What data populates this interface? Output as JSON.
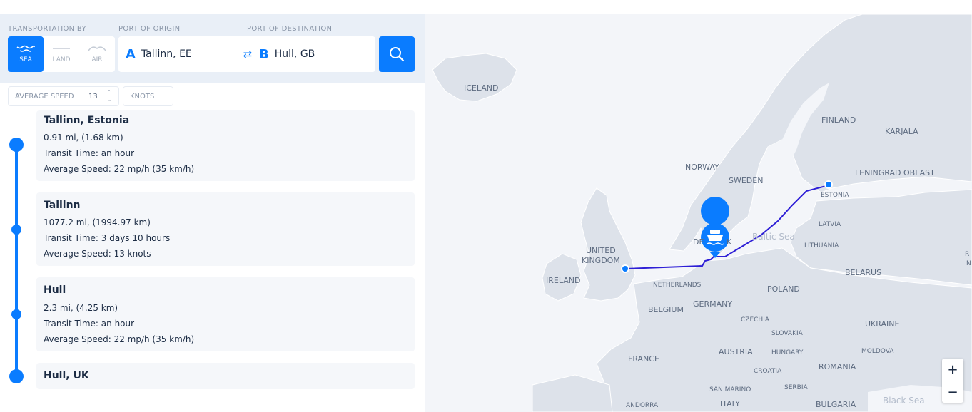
{
  "search": {
    "transport_label": "TRANSPORTATION BY",
    "origin_label": "PORT OF ORIGIN",
    "destination_label": "PORT OF DESTINATION",
    "modes": [
      {
        "label": "SEA",
        "icon": "waves-icon",
        "active": true
      },
      {
        "label": "LAND",
        "icon": "road-icon",
        "active": false
      },
      {
        "label": "AIR",
        "icon": "arc-icon",
        "active": false
      }
    ],
    "origin_letter": "A",
    "origin_value": "Tallinn, EE",
    "swap_icon": "⇄",
    "destination_letter": "B",
    "destination_value": "Hull, GB",
    "search_icon": "search-icon"
  },
  "speed": {
    "label": "AVERAGE SPEED",
    "value": "13",
    "unit": "KNOTS"
  },
  "legs": [
    {
      "title": "Tallinn, Estonia",
      "distance": "0.91 mi, (1.68 km)",
      "transit": "Transit Time: an hour",
      "speed": "Average Speed: 22 mp/h (35 km/h)"
    },
    {
      "title": "Tallinn",
      "distance": "1077.2 mi, (1994.97 km)",
      "transit": "Transit Time: 3 days 10 hours",
      "speed": "Average Speed: 13 knots"
    },
    {
      "title": "Hull",
      "distance": "2.3 mi, (4.25 km)",
      "transit": "Transit Time: an hour",
      "speed": "Average Speed: 22 mp/h (35 km/h)"
    },
    {
      "title": "Hull, UK"
    }
  ],
  "map": {
    "labels": {
      "iceland": "ICELAND",
      "finland": "FINLAND",
      "karjala": "KARJALA",
      "norway": "NORWAY",
      "sweden": "SWEDEN",
      "leningrad": "LENINGRAD OBLAST",
      "estonia": "ESTONIA",
      "latvia": "LATVIA",
      "baltic": "Baltic Sea",
      "lithuania": "LITHUANIA",
      "denmark": "DE",
      "denmark2": "K",
      "uk": "UNITED",
      "uk2": "KINGDOM",
      "belarus": "BELARUS",
      "ireland": "IRELAND",
      "netherlands": "NETHERLANDS",
      "poland": "POLAND",
      "germany": "GERMANY",
      "belgium": "BELGIUM",
      "czechia": "CZECHIA",
      "ukraine": "UKRAINE",
      "slovakia": "SLOVAKIA",
      "austria": "AUSTRIA",
      "hungary": "HUNGARY",
      "moldova": "MOLDOVA",
      "france": "FRANCE",
      "croatia": "CROATIA",
      "romania": "ROMANIA",
      "serbia": "SERBIA",
      "san_marino": "SAN MARINO",
      "italy": "ITALY",
      "bulgaria": "BULGARIA",
      "andorra": "ANDORRA",
      "black_sea": "Black Sea",
      "edge_r": "R",
      "edge_n": "N"
    },
    "zoom_in": "+",
    "zoom_out": "−",
    "route_color": "#2e1fd6",
    "accent": "#0a7cff"
  }
}
